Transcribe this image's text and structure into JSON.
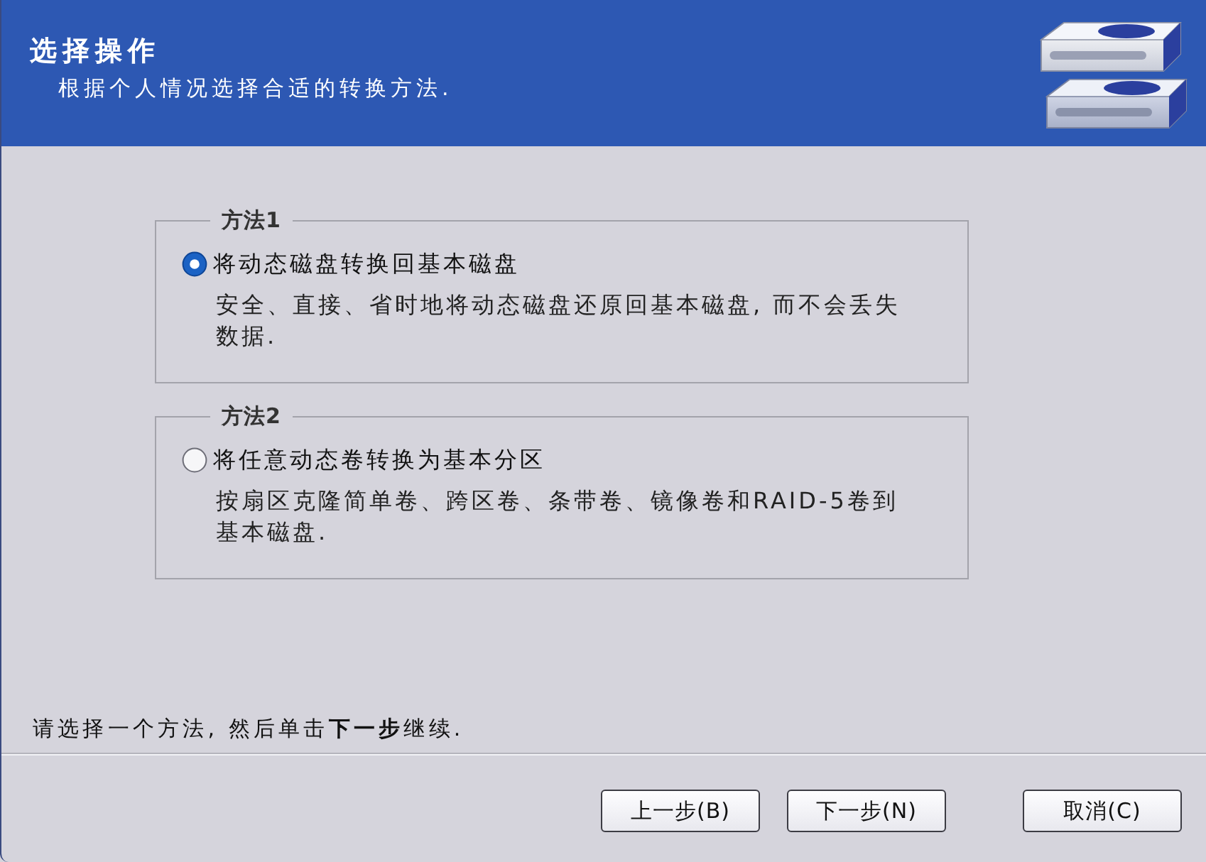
{
  "header": {
    "title": "选择操作",
    "subtitle": "根据个人情况选择合适的转换方法."
  },
  "groups": [
    {
      "legend": "方法1",
      "option": {
        "label": "将动态磁盘转换回基本磁盘",
        "selected": true
      },
      "description": "安全、直接、省时地将动态磁盘还原回基本磁盘, 而不会丢失数据."
    },
    {
      "legend": "方法2",
      "option": {
        "label": "将任意动态卷转换为基本分区",
        "selected": false
      },
      "description": "按扇区克隆简单卷、跨区卷、条带卷、镜像卷和RAID-5卷到基本磁盘."
    }
  ],
  "instruction": "请选择一个方法, 然后单击**下一步**继续.",
  "buttons": [
    {
      "label": "上一步(B)"
    },
    {
      "label": "下一步(N)"
    },
    {
      "label": "取消(C)"
    }
  ]
}
